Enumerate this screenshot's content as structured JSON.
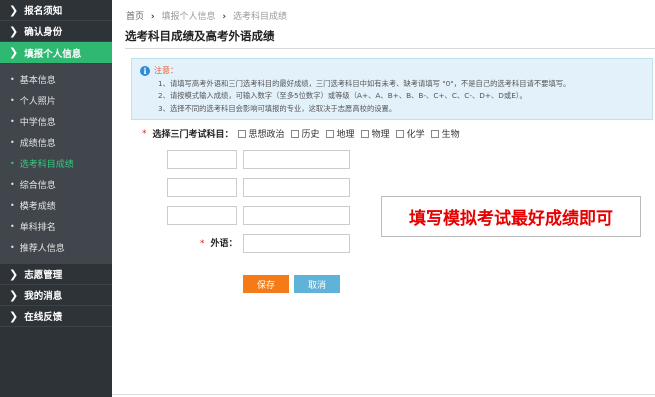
{
  "sidebar": {
    "top_items": [
      {
        "label": "报名须知"
      },
      {
        "label": "确认身份"
      },
      {
        "label": "填报个人信息"
      }
    ],
    "sub_items": [
      {
        "label": "基本信息"
      },
      {
        "label": "个人照片"
      },
      {
        "label": "中学信息"
      },
      {
        "label": "成绩信息"
      },
      {
        "label": "选考科目成绩"
      },
      {
        "label": "综合信息"
      },
      {
        "label": "模考成绩"
      },
      {
        "label": "单科排名"
      },
      {
        "label": "推荐人信息"
      }
    ],
    "bottom_items": [
      {
        "label": "志愿管理"
      },
      {
        "label": "我的消息"
      },
      {
        "label": "在线反馈"
      }
    ],
    "arrow": "❯",
    "dot": "•"
  },
  "breadcrumb": {
    "home": "首页",
    "level1": "填报个人信息",
    "level2": "选考科目成绩",
    "sep": "›"
  },
  "page_title": "选考科目成绩及高考外语成绩",
  "notice": {
    "icon": "i",
    "title": "注意：",
    "lines": [
      "1、请填写高考外语和三门选考科目的最好成绩，三门选考科目中如有未考、缺考请填写 \"0\"，不是自己的选考科目请不要填写。",
      "2、请按模式输入成绩，可输入数字（至多5位数字）或等级（A+、A、B+、B、B-、C+、C、C-、D+、D或E）。",
      "3、选择不同的选考科目会影响可填报的专业，这取决于志愿高校的设置。"
    ]
  },
  "subjects": {
    "required_mark": "*",
    "label": "选择三门考试科目：",
    "options": [
      "思想政治",
      "历史",
      "地理",
      "物理",
      "化学",
      "生物"
    ]
  },
  "foreign": {
    "required_mark": "*",
    "label": "外语："
  },
  "annotation": "填写模拟考试最好成绩即可",
  "buttons": {
    "save": "保存",
    "cancel": "取消"
  },
  "colors": {
    "sidebar_bg": "#2e3338",
    "active_green": "#2eb872",
    "save_orange": "#f47b17",
    "cancel_blue": "#5fb3d8",
    "annotation_red": "#e60000"
  }
}
